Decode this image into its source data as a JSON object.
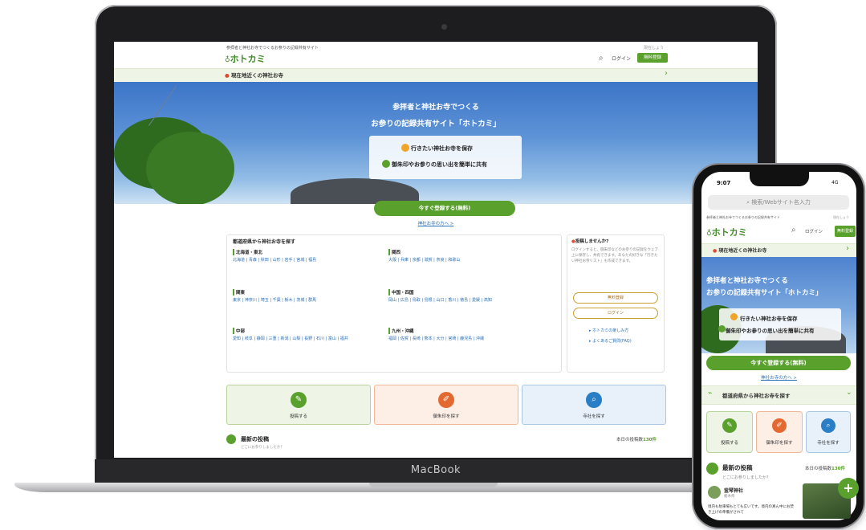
{
  "laptop": {
    "brand": "MacBook",
    "site": {
      "tagline": "参拝者と神社お寺でつくるお参りの記録共有サイト",
      "tagline_right": "現在しょう",
      "logo": "ホトカミ",
      "login": "ログイン",
      "register": "無料登録",
      "location_bar": "現在地近くの神社お寺",
      "hero_line1": "参拝者と神社お寺でつくる",
      "hero_line2": "お参りの記録共有サイト「ホトカミ」",
      "card_line1": "行きたい神社お寺を保存",
      "card_line2": "御朱印やお参りの思い出を簡単に共有",
      "cta": "今すぐ登録する(無料)",
      "cta_sub": "神社お寺の方へ >",
      "pref_title": "都道府県から神社お寺を探す",
      "regions": [
        {
          "name": "北海道・東北",
          "prefs": "北海道 | 青森 | 秋田 | 山形 | 岩手 | 宮城 | 福島"
        },
        {
          "name": "関西",
          "prefs": "大阪 | 兵庫 | 京都 | 滋賀 | 奈良 | 和歌山"
        },
        {
          "name": "関東",
          "prefs": "東京 | 神奈川 | 埼玉 | 千葉 | 栃木 | 茨城 | 群馬"
        },
        {
          "name": "中国・四国",
          "prefs": "岡山 | 広島 | 鳥取 | 島根 | 山口 | 香川 | 徳島 | 愛媛 | 高知"
        },
        {
          "name": "中部",
          "prefs": "愛知 | 岐阜 | 静岡 | 三重 | 新潟 | 山梨 | 長野 | 石川 | 富山 | 福井"
        },
        {
          "name": "九州・沖縄",
          "prefs": "福岡 | 佐賀 | 長崎 | 熊本 | 大分 | 宮崎 | 鹿児島 | 沖縄"
        }
      ],
      "side_title": "投稿しませんか?",
      "side_text": "ログインすると、御朱印などのお参りの記録をウェブ上に保存し、共有できます。あなたの好きな「行きたい神社お寺リスト」も作成できます。",
      "side_btn1": "無料登録",
      "side_btn2": "ログイン",
      "side_link1": "▸ ホトカミの楽しみ方",
      "side_link2": "▸ よくあるご質問(FAQ)",
      "actions": [
        "投稿する",
        "御朱印を探す",
        "寺社を探す"
      ],
      "latest_title": "最新の投稿",
      "latest_sub": "どこにお参りしましたか?",
      "today_count_label": "本日の投稿数",
      "today_count": "130件"
    }
  },
  "phone": {
    "time": "9:07",
    "status": "4G",
    "url_placeholder": "検索/Webサイト名入力",
    "tagline": "参拝者と神社お寺でつくるお参りの記録共有サイト",
    "tagline_right": "現在しょう",
    "logo": "ホトカミ",
    "login": "ログイン",
    "register": "無料登録",
    "location_bar": "現在地近くの神社お寺",
    "hero_line1": "参拝者と神社お寺でつくる",
    "hero_line2": "お参りの記録共有サイト「ホトカミ」",
    "card_line1": "行きたい神社お寺を保存",
    "card_line2": "御朱印やお参りの思い出を簡単に共有",
    "cta": "今すぐ登録する(無料)",
    "cta_sub": "神社お寺の方へ >",
    "pref_bar": "都道府県から神社お寺を探す",
    "actions": [
      "投稿する",
      "御朱印を探す",
      "寺社を探す"
    ],
    "latest_title": "最新の投稿",
    "latest_sub": "どこにお参りしましたか?",
    "today_count_label": "本日の投稿数",
    "today_count": "130件",
    "post_name": "釜琴神社",
    "post_loc": "栃木県",
    "post_text": "境内も駐車場もとても広いです。境内の真ん中にお焚き上げの準備がされて"
  },
  "colors": {
    "accent": "#5aa02c",
    "link": "#2a6fb5",
    "orange": "#e4692f",
    "blue": "#2a7ec6"
  }
}
